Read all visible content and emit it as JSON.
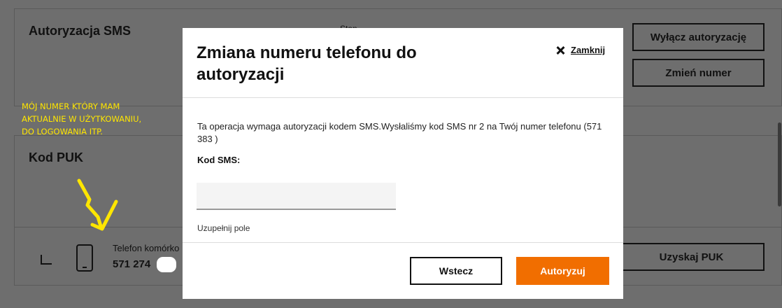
{
  "background": {
    "sms_card": {
      "title": "Autoryzacja SMS",
      "status_label": "Stan",
      "disable_button": "Wyłącz autoryzację",
      "change_number_button": "Zmień numer"
    },
    "puk_card": {
      "title": "Kod PUK",
      "phone_label": "Telefon komórko",
      "phone_number": "571 274",
      "get_puk_button": "Uzyskaj PUK"
    },
    "annotation": {
      "line1": "MÓJ NUMER KTÓRY MAM",
      "line2": "AKTUALNIE W UŻYTKOWANIU,",
      "line3": "DO LOGOWANIA ITP."
    }
  },
  "modal": {
    "title": "Zmiana numeru telefonu do autoryzacji",
    "close_label": "Zamknij",
    "description": "Ta operacja wymaga autoryzacji kodem SMS.Wysłaliśmy kod SMS nr 2 na Twój numer telefonu (571 383       )",
    "sms_label": "Kod SMS:",
    "sms_value": "",
    "hint": "Uzupełnij pole",
    "back_button": "Wstecz",
    "authorize_button": "Autoryzuj"
  },
  "colors": {
    "accent": "#f16e00",
    "overlay": "#6e6e6e",
    "annotation": "#ffe600"
  },
  "icons": [
    "close-icon",
    "mobile-phone-icon",
    "arrow-annotation-icon",
    "corner-icon"
  ]
}
